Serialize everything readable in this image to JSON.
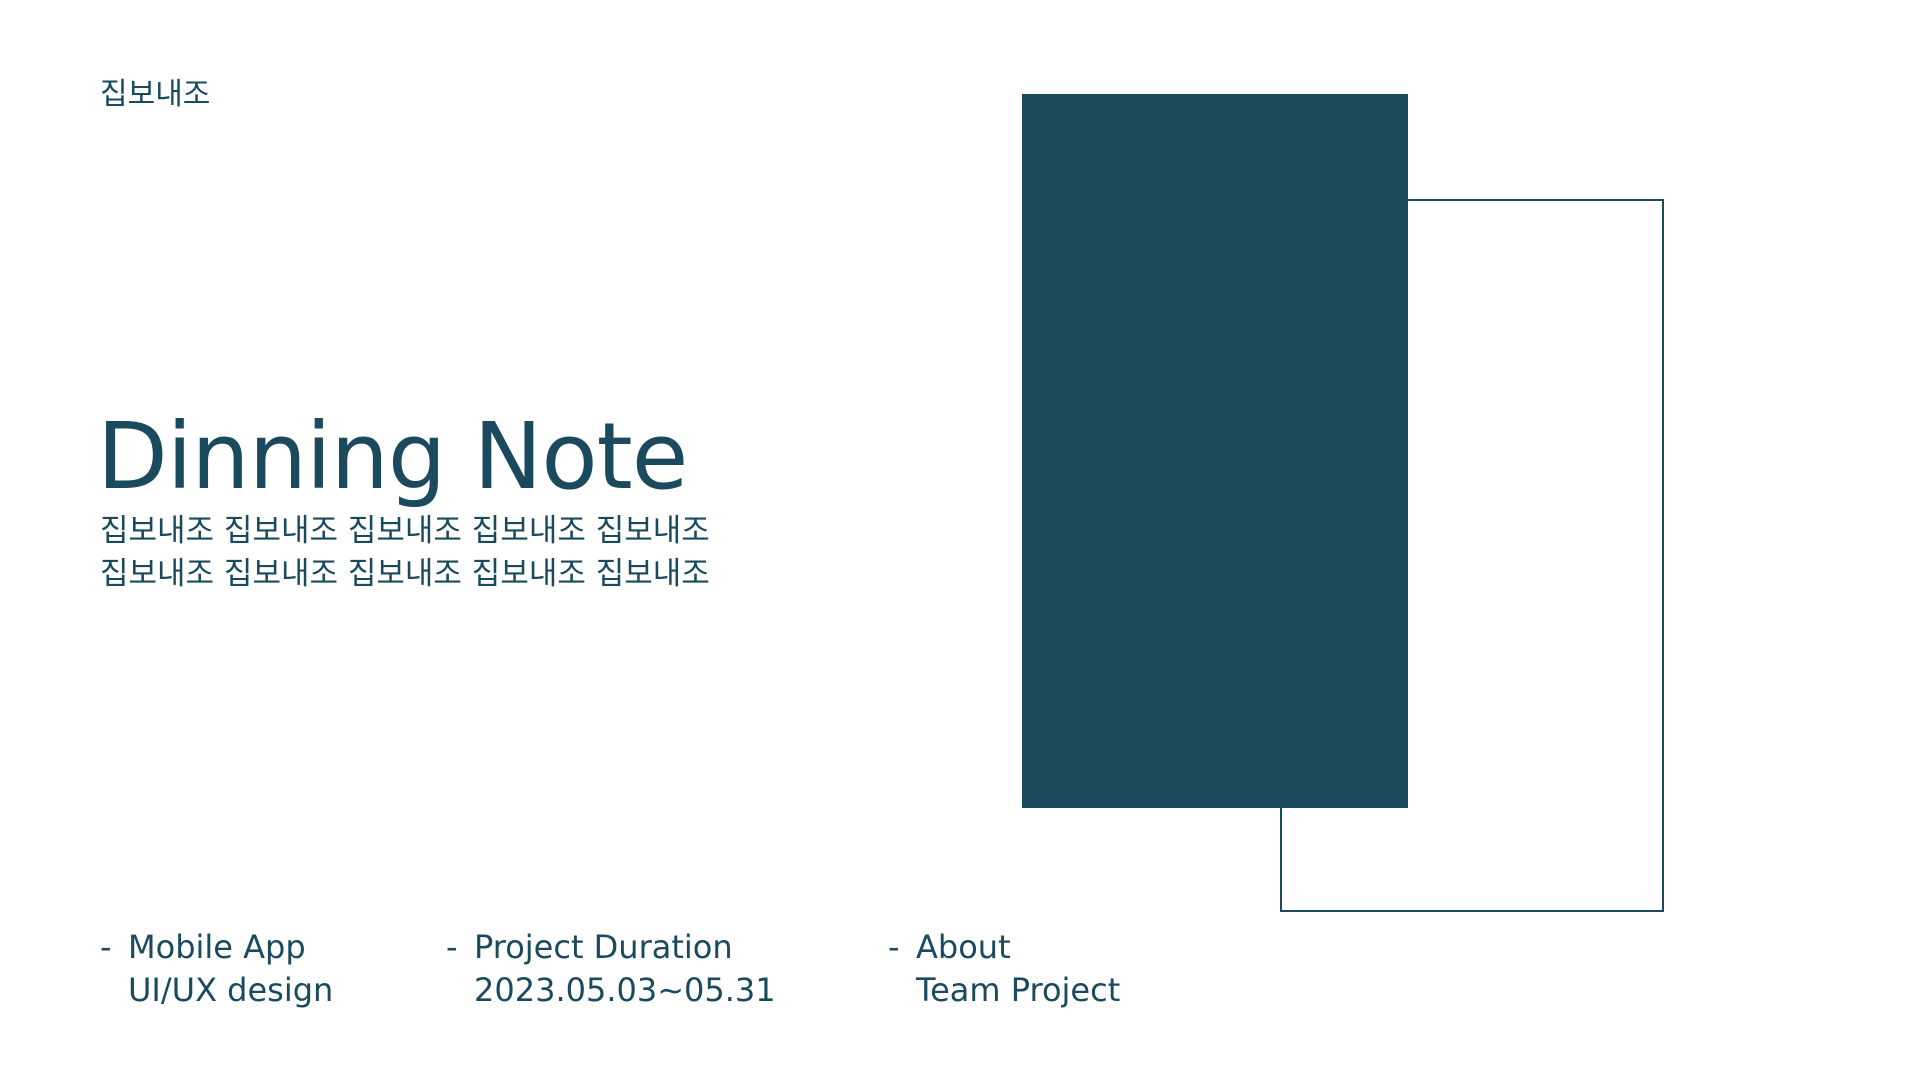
{
  "brand": "집보내조",
  "title": "Dinning Note",
  "subtitle_lines": [
    "집보내조 집보내조 집보내조 집보내조 집보내조",
    "집보내조 집보내조 집보내조 집보내조 집보내조"
  ],
  "info": [
    {
      "dash": "-",
      "line1": "Mobile App",
      "line2": "UI/UX design"
    },
    {
      "dash": "-",
      "line1": "Project Duration",
      "line2": "2023.05.03~05.31"
    },
    {
      "dash": "-",
      "line1": "About",
      "line2": "Team Project"
    }
  ],
  "colors": {
    "primary": "#1b4a5f",
    "background": "#ffffff"
  }
}
